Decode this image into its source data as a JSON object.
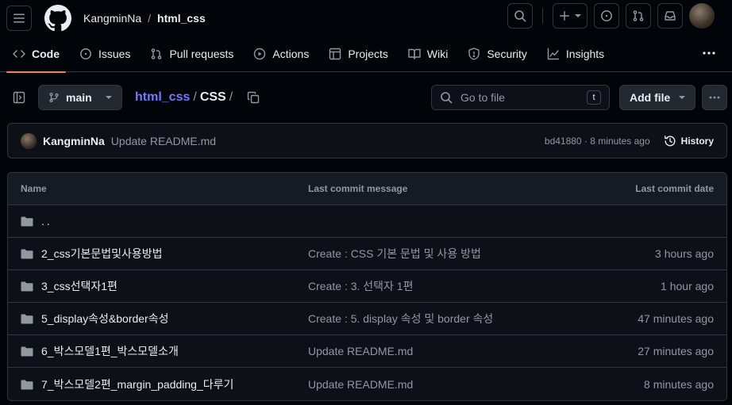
{
  "header": {
    "owner": "KangminNa",
    "separator": "/",
    "repo": "html_css"
  },
  "nav": {
    "tabs": [
      {
        "label": "Code",
        "icon": "code-icon"
      },
      {
        "label": "Issues",
        "icon": "issue-opened-icon"
      },
      {
        "label": "Pull requests",
        "icon": "git-pull-request-icon"
      },
      {
        "label": "Actions",
        "icon": "play-icon"
      },
      {
        "label": "Projects",
        "icon": "table-icon"
      },
      {
        "label": "Wiki",
        "icon": "book-icon"
      },
      {
        "label": "Security",
        "icon": "shield-icon"
      },
      {
        "label": "Insights",
        "icon": "graph-icon"
      }
    ]
  },
  "filebar": {
    "branch": "main",
    "path_repo": "html_css",
    "path_sep": "/",
    "path_dir": "CSS",
    "path_trailing": "/",
    "goto_placeholder": "Go to file",
    "goto_shortcut": "t",
    "add_file": "Add file"
  },
  "commit": {
    "author": "KangminNa",
    "message": "Update README.md",
    "meta": "bd41880 · 8 minutes ago",
    "history": "History"
  },
  "table": {
    "headers": {
      "name": "Name",
      "message": "Last commit message",
      "date": "Last commit date"
    },
    "parent": "..",
    "rows": [
      {
        "name": "2_css기본문법및사용방법",
        "message": "Create : CSS 기본 문법 및 사용 방법",
        "date": "3 hours ago"
      },
      {
        "name": "3_css선택자1편",
        "message": "Create : 3. 선택자 1편",
        "date": "1 hour ago"
      },
      {
        "name": "5_display속성&border속성",
        "message": "Create : 5. display 속성 및 border 속성",
        "date": "47 minutes ago"
      },
      {
        "name": "6_박스모델1편_박스모델소개",
        "message": "Update README.md",
        "date": "27 minutes ago"
      },
      {
        "name": "7_박스모델2편_margin_padding_다루기",
        "message": "Update README.md",
        "date": "8 minutes ago"
      }
    ]
  },
  "colors": {
    "background": "#010409",
    "accent_underline": "#f78166",
    "link": "#6e7bff"
  }
}
